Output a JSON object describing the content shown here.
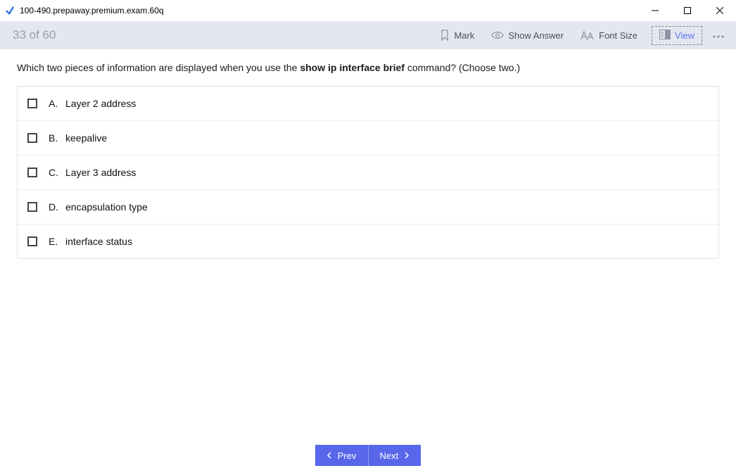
{
  "window": {
    "title": "100-490.prepaway.premium.exam.60q"
  },
  "toolbar": {
    "progress": "33 of 60",
    "mark": "Mark",
    "show_answer": "Show Answer",
    "font_size": "Font Size",
    "view": "View"
  },
  "question": {
    "prefix": "Which two pieces of information are displayed when you use the ",
    "command": "show ip interface brief",
    "suffix": " command? (Choose two.)"
  },
  "options": [
    {
      "letter": "A.",
      "text": "Layer 2 address"
    },
    {
      "letter": "B.",
      "text": "keepalive"
    },
    {
      "letter": "C.",
      "text": "Layer 3 address"
    },
    {
      "letter": "D.",
      "text": "encapsulation type"
    },
    {
      "letter": "E.",
      "text": "interface status"
    }
  ],
  "nav": {
    "prev": "Prev",
    "next": "Next"
  }
}
